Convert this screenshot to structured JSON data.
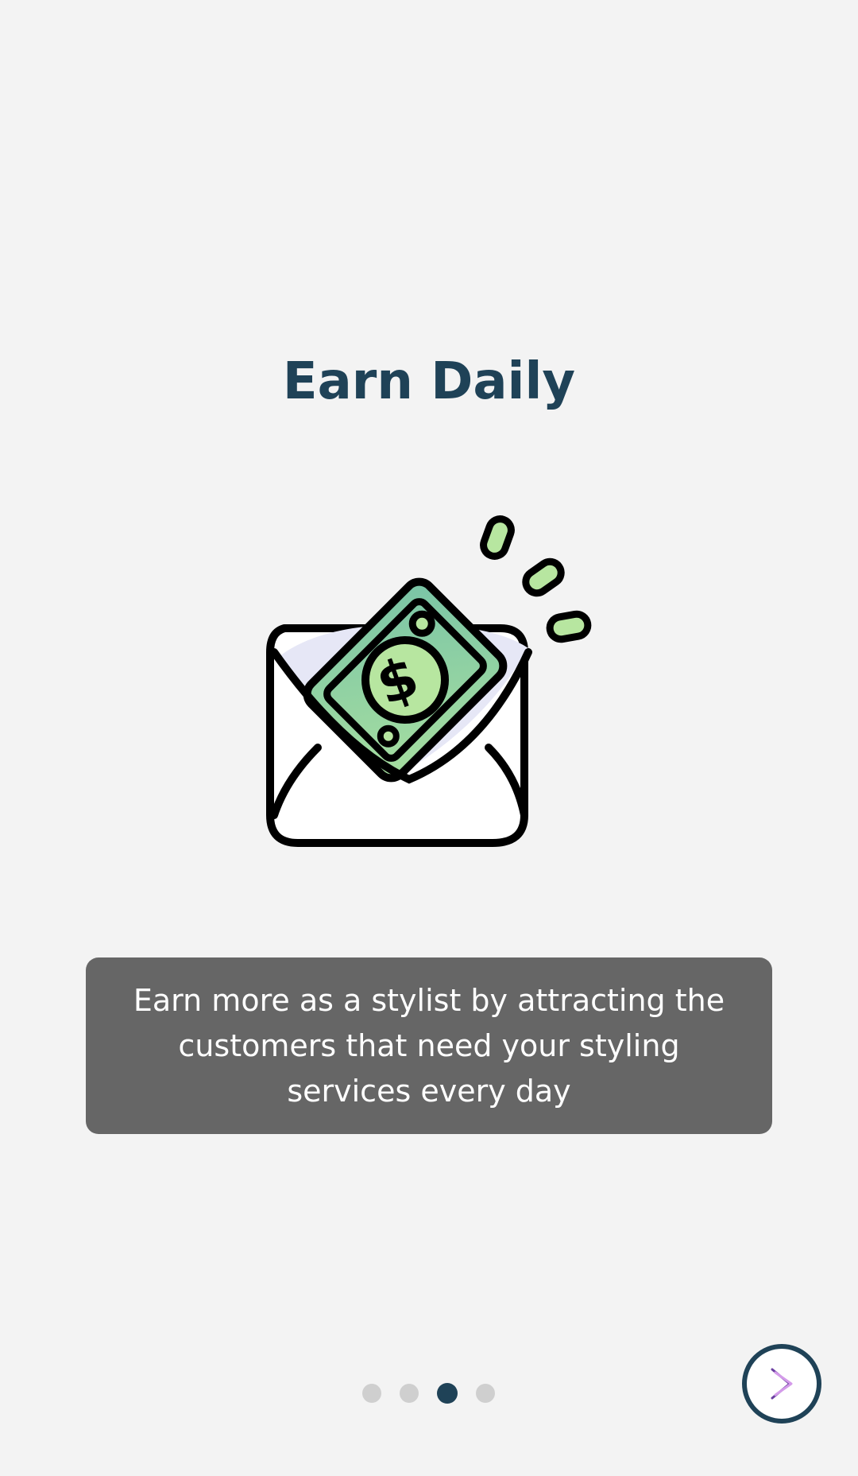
{
  "onboarding": {
    "title": "Earn Daily",
    "description": "Earn more as a stylist by attracting the customers that need your styling services every day",
    "illustration_icon": "money-envelope-icon",
    "pagination": {
      "total": 4,
      "active_index": 2
    },
    "next_icon": "chevron-right-icon"
  },
  "colors": {
    "background": "#f3f3f3",
    "title": "#1f4257",
    "description_box": "#666666",
    "description_text": "#ffffff",
    "dot_inactive": "#cfcfcf",
    "dot_active": "#1f4257",
    "money_green": "#9fd8a0",
    "chevron_accent": "#c77ce0"
  }
}
